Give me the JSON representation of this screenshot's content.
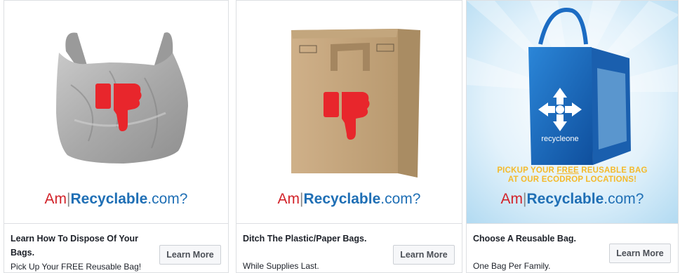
{
  "ads": [
    {
      "headline": "Learn How To Dispose Of Your Bags.",
      "description": "Pick Up Your FREE Reusable Bag!",
      "button": "Learn More",
      "image": "plastic-bag-thumbs-down",
      "brand": {
        "am": "Am",
        "bar": "|",
        "recyclable": "Recyclable",
        "domain": ".com?"
      }
    },
    {
      "headline": "Ditch The Plastic/Paper Bags.",
      "description": "While Supplies Last.",
      "button": "Learn More",
      "image": "paper-bag-thumbs-down",
      "brand": {
        "am": "Am",
        "bar": "|",
        "recyclable": "Recyclable",
        "domain": ".com?"
      }
    },
    {
      "headline": "Choose A Reusable Bag.",
      "description": "One Bag Per Family.",
      "button": "Learn More",
      "image": "reusable-bag-recycleone",
      "promo_line1_a": "PICKUP YOUR ",
      "promo_line1_free": "FREE",
      "promo_line1_b": " REUSABLE BAG",
      "promo_line2": "AT OUR ECODROP LOCATIONS!",
      "bag_brand": "recycleone",
      "brand": {
        "am": "Am",
        "bar": "|",
        "recyclable": "Recyclable",
        "domain": ".com?"
      }
    }
  ],
  "colors": {
    "brand_red": "#d2232a",
    "brand_blue": "#1f6fb5",
    "promo_yellow": "#f4b92a",
    "thumb_red": "#e8262c"
  }
}
